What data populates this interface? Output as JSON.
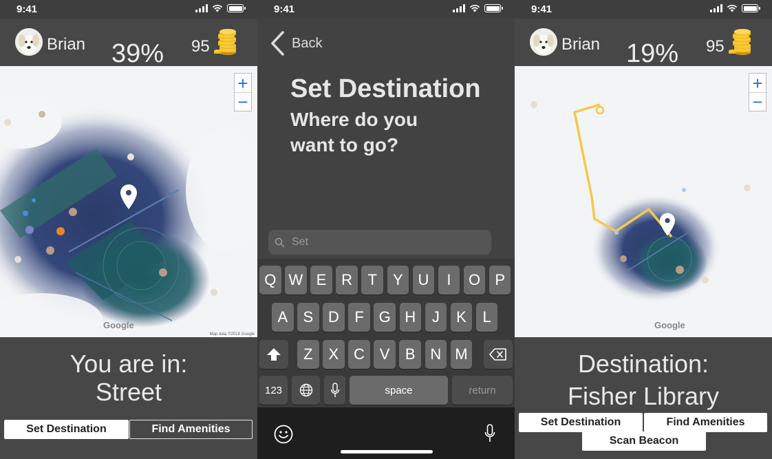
{
  "status": {
    "time": "9:41"
  },
  "screen1": {
    "user": {
      "name": "Brian",
      "percent": "39%",
      "coins": "95"
    },
    "zoom": {
      "in": "+",
      "out": "−"
    },
    "map": {
      "logo": "Google",
      "credit": "Map data ©2018 Google"
    },
    "info": {
      "line1": "You are in:",
      "line2": "Street"
    },
    "buttons": {
      "set_destination": "Set Destination",
      "find_amenities": "Find Amenities"
    }
  },
  "screen2": {
    "back_label": "Back",
    "title": "Set Destination",
    "subtitle": "Where do you want to go?",
    "search": {
      "placeholder": "Set"
    },
    "keyboard": {
      "row1": [
        "Q",
        "W",
        "E",
        "R",
        "T",
        "Y",
        "U",
        "I",
        "O",
        "P"
      ],
      "row2": [
        "A",
        "S",
        "D",
        "F",
        "G",
        "H",
        "J",
        "K",
        "L"
      ],
      "row3": [
        "Z",
        "X",
        "C",
        "V",
        "B",
        "N",
        "M"
      ],
      "numbers_key": "123",
      "space_key": "space",
      "return_key": "return"
    }
  },
  "screen3": {
    "user": {
      "name": "Brian",
      "percent": "19%",
      "coins": "95"
    },
    "zoom": {
      "in": "+",
      "out": "−"
    },
    "map": {
      "logo": "Google"
    },
    "info": {
      "line1": "Destination:",
      "line2": "Fisher Library"
    },
    "buttons": {
      "set_destination": "Set Destination",
      "find_amenities": "Find Amenities",
      "scan_beacon": "Scan Beacon"
    }
  },
  "colors": {
    "route": "#f2c94c",
    "map_dark": "#2c3e6e",
    "map_teal": "#1f5e63",
    "zoom_blue": "#1a73e8"
  }
}
